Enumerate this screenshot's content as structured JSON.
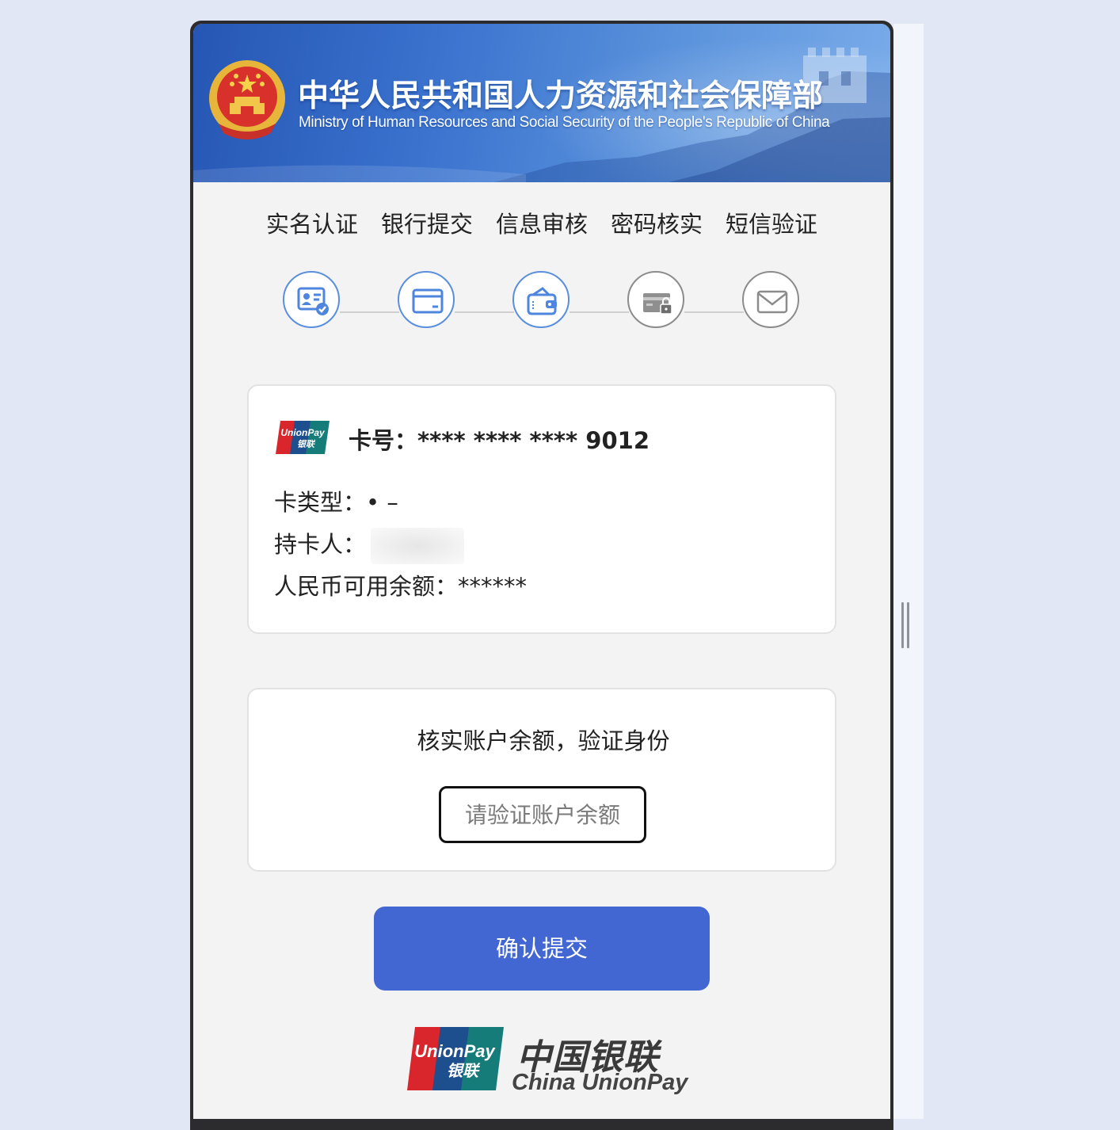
{
  "header": {
    "title_cn": "中华人民共和国人力资源和社会保障部",
    "title_en": "Ministry of Human Resources and Social Security of the People's Republic of China"
  },
  "steps": [
    {
      "label": "实名认证",
      "icon": "id-card-check-icon",
      "active": true
    },
    {
      "label": "银行提交",
      "icon": "bank-card-icon",
      "active": true
    },
    {
      "label": "信息审核",
      "icon": "wallet-icon",
      "active": true
    },
    {
      "label": "密码核实",
      "icon": "card-lock-icon",
      "active": false
    },
    {
      "label": "短信验证",
      "icon": "envelope-icon",
      "active": false
    }
  ],
  "card_info": {
    "logo_text": "UnionPay 银联",
    "number_label": "卡号：",
    "number_value": "**** **** **** 9012",
    "type_label": "卡类型：",
    "type_value": "• –",
    "holder_label": "持卡人：",
    "balance_label": "人民币可用余额：",
    "balance_value": "******"
  },
  "verify": {
    "title": "核实账户余额，验证身份",
    "input_placeholder": "请验证账户余额",
    "input_value": ""
  },
  "submit_label": "确认提交",
  "footer": {
    "brand_cn": "中国银联",
    "brand_en": "China UnionPay",
    "logo_text": "UnionPay 银联"
  },
  "colors": {
    "accent": "#4267d3",
    "step_active": "#5a8fde",
    "step_inactive": "#8c8c8c",
    "banner": "#3b73cf"
  }
}
